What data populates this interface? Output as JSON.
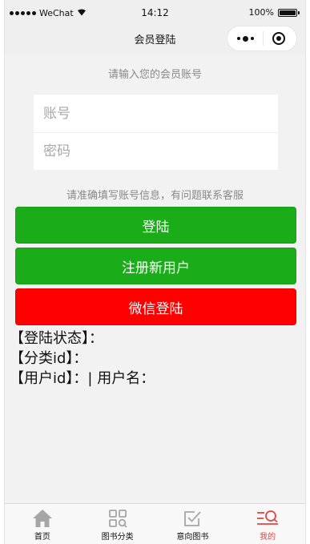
{
  "status_bar": {
    "carrier": "WeChat",
    "time": "14:12",
    "battery": "100%",
    "battery_level": 1.0
  },
  "nav": {
    "title": "会员登陆"
  },
  "login": {
    "prompt": "请输入您的会员账号",
    "account_placeholder": "账号",
    "password_placeholder": "密码",
    "hint": "请准确填写账号信息，有问题联系客服",
    "login_button": "登陆",
    "register_button": "注册新用户",
    "wechat_button": "微信登陆"
  },
  "info": {
    "login_status": "【登陆状态】：",
    "category_id": "【分类id】：",
    "user_line": "【用户id】：| 用户名："
  },
  "tabs": [
    {
      "label": "首页",
      "icon": "home-icon"
    },
    {
      "label": "图书分类",
      "icon": "category-grid-icon"
    },
    {
      "label": "意向图书",
      "icon": "checkbox-icon"
    },
    {
      "label": "我的",
      "icon": "profile-search-icon"
    }
  ],
  "colors": {
    "green": "#1aad19",
    "red": "#ff0000",
    "tab_active": "#e64340",
    "tab_inactive": "#a6a6a6"
  }
}
